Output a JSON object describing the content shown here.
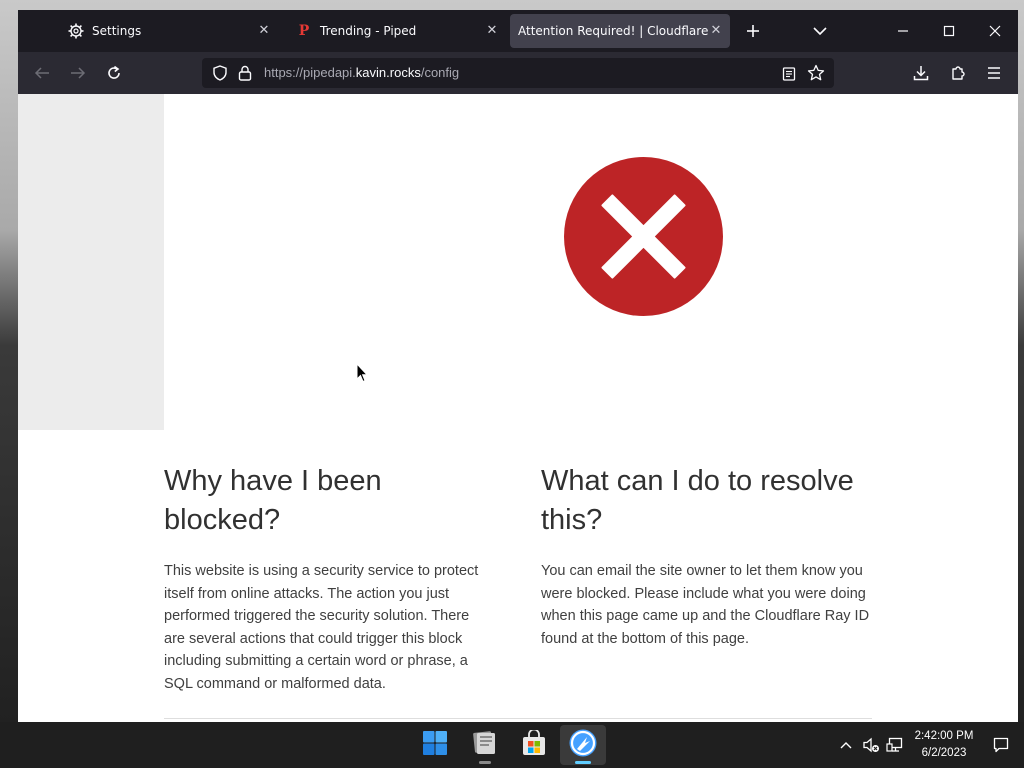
{
  "browser": {
    "tabs": [
      {
        "label": "Settings",
        "icon": "gear-icon",
        "active": false
      },
      {
        "label": "Trending - Piped",
        "icon": "piped-p-icon",
        "icon_glyph": "P",
        "active": false
      },
      {
        "label": "Attention Required! | Cloudflare",
        "icon": "none",
        "active": true
      }
    ],
    "url": {
      "prefix": "https://pipedapi.",
      "host": "kavin.rocks",
      "suffix": "/config"
    }
  },
  "page": {
    "status_icon": "error-x-circle-icon",
    "accent_color": "#bd2426",
    "sections": [
      {
        "heading": "Why have I been blocked?",
        "body": "This website is using a security service to protect itself from online attacks. The action you just performed triggered the security solution. There are several actions that could trigger this block including submitting a certain word or phrase, a SQL command or malformed data."
      },
      {
        "heading": "What can I do to resolve this?",
        "body": "You can email the site owner to let them know you were blocked. Please include what you were doing when this page came up and the Cloudflare Ray ID found at the bottom of this page."
      }
    ]
  },
  "taskbar": {
    "apps": [
      "start-icon",
      "file-explorer-icon",
      "microsoft-store-icon",
      "firefox-icon"
    ],
    "active_app": "firefox-icon",
    "clock": {
      "time": "2:42:00 PM",
      "date": "6/2/2023"
    }
  }
}
